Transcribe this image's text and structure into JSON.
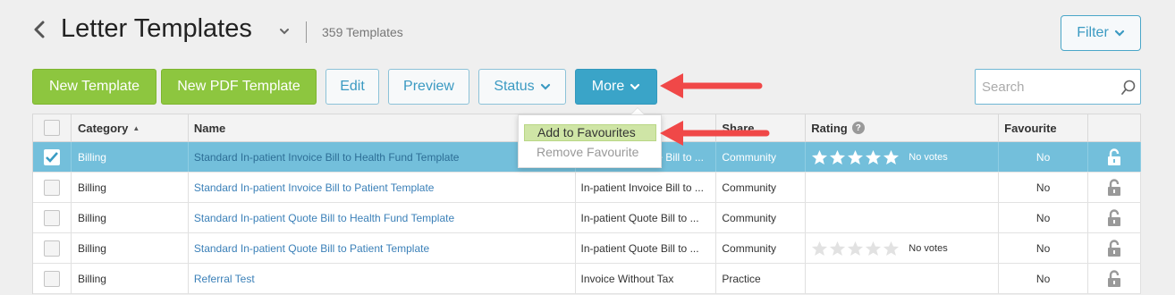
{
  "header": {
    "title": "Letter Templates",
    "count": "359 Templates",
    "filter_label": "Filter"
  },
  "toolbar": {
    "new_template": "New Template",
    "new_pdf_template": "New PDF Template",
    "edit": "Edit",
    "preview": "Preview",
    "status": "Status",
    "more": "More",
    "search_placeholder": "Search"
  },
  "more_menu": {
    "add_favourites": "Add to Favourites",
    "remove_favourite": "Remove Favourite"
  },
  "table": {
    "headers": {
      "category": "Category",
      "name": "Name",
      "share": "Share",
      "rating": "Rating",
      "favourite": "Favourite"
    },
    "rows": [
      {
        "checked": true,
        "category": "Billing",
        "name": "Standard In-patient Invoice Bill to Health Fund Template",
        "description": "In-patient Invoice Bill to ...",
        "share": "Community",
        "stars": 5,
        "votes": "No votes",
        "favourite": "No",
        "selected": true
      },
      {
        "checked": false,
        "category": "Billing",
        "name": "Standard In-patient Invoice Bill to Patient Template",
        "description": "In-patient Invoice Bill to ...",
        "share": "Community",
        "stars": 0,
        "votes": "",
        "favourite": "No",
        "selected": false
      },
      {
        "checked": false,
        "category": "Billing",
        "name": "Standard In-patient Quote Bill to Health Fund Template",
        "description": "In-patient Quote Bill to ...",
        "share": "Community",
        "stars": 0,
        "votes": "",
        "favourite": "No",
        "selected": false
      },
      {
        "checked": false,
        "category": "Billing",
        "name": "Standard In-patient Quote Bill to Patient Template",
        "description": "In-patient Quote Bill to ...",
        "share": "Community",
        "stars": 5,
        "votes": "No votes",
        "favourite": "No",
        "selected": false
      },
      {
        "checked": false,
        "category": "Billing",
        "name": "Referral Test",
        "description": "Invoice Without Tax",
        "share": "Practice",
        "stars": 0,
        "votes": "",
        "favourite": "No",
        "selected": false
      }
    ]
  },
  "colors": {
    "accent_blue": "#3aa4c8",
    "green_button": "#8dc63f",
    "selected_row": "#73bfdb",
    "annotation_arrow": "#f04848"
  }
}
